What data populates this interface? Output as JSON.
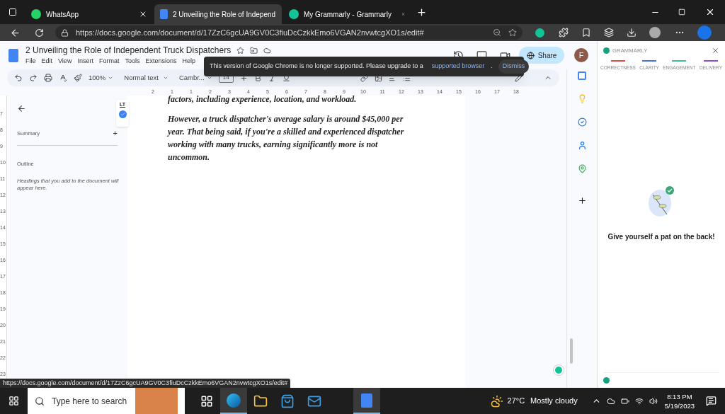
{
  "browser_tabs": [
    {
      "title": "WhatsApp",
      "selected": false
    },
    {
      "title": "2 Unveiling the Role of Independ",
      "selected": true
    },
    {
      "title": "My Grammarly - Grammarly",
      "selected": false
    }
  ],
  "address_bar": {
    "url": "https://docs.google.com/document/d/17ZzC6gcUA9GV0C3fiuDcCzkkEmo6VGAN2nvwtcgXO1s/edit#"
  },
  "document": {
    "title": "2 Unveiling the Role of Independent Truck Dispatchers",
    "menu": [
      "File",
      "Edit",
      "View",
      "Insert",
      "Format",
      "Tools",
      "Extensions",
      "Help"
    ],
    "share_label": "Share",
    "avatar_letter": "F",
    "toolbar": {
      "zoom": "100%",
      "style": "Normal text",
      "font": "Cambr...",
      "font_size": "14"
    },
    "ruler_labels": [
      "2",
      "1",
      "1",
      "2",
      "3",
      "4",
      "5",
      "6",
      "7",
      "8",
      "9",
      "10",
      "11",
      "12",
      "13",
      "14",
      "15",
      "16",
      "17",
      "18"
    ],
    "vertical_ruler_labels": [
      "7",
      "8",
      "9",
      "10",
      "11",
      "12",
      "13",
      "14",
      "15",
      "16",
      "17",
      "18",
      "19",
      "20",
      "21",
      "22",
      "23"
    ],
    "outline": {
      "summary_label": "Summary",
      "add_label": "+",
      "outline_label": "Outline",
      "hint": "Headings that you add to the document will appear here."
    },
    "lt_label": "LT",
    "paragraphs": [
      "factors, including experience, location, and workload.",
      "However, a truck dispatcher's average salary is around $45,000 per year. That being said, if you're a skilled and experienced dispatcher working with many trucks, earning significantly more is not uncommon."
    ]
  },
  "toast": {
    "message": "This version of Google Chrome is no longer supported. Please upgrade to a",
    "link": "supported browser",
    "period": ".",
    "dismiss": "Dismiss"
  },
  "grammarly": {
    "brand": "GRAMMARLY",
    "categories": [
      {
        "label": "CORRECTNESS",
        "color": "#e0484d"
      },
      {
        "label": "CLARITY",
        "color": "#4a6ee0"
      },
      {
        "label": "ENGAGEMENT",
        "color": "#3fbf8f"
      },
      {
        "label": "DELIVERY",
        "color": "#8a4fd0"
      }
    ],
    "message": "Give yourself a pat on the back!"
  },
  "status_url": "https://docs.google.com/document/d/17ZzC6gcUA9GV0C3fiuDcCzkkEmo6VGAN2nvwtcgXO1s/edit#",
  "taskbar": {
    "search_placeholder": "Type here to search",
    "apps": [
      {
        "kind": "taskview",
        "selected": false
      },
      {
        "kind": "edge",
        "selected": true
      },
      {
        "kind": "explorer",
        "selected": false
      },
      {
        "kind": "store",
        "selected": false
      },
      {
        "kind": "mail",
        "selected": false
      },
      {
        "kind": "docs",
        "selected": true
      }
    ],
    "temperature": "27°C",
    "weather": "Mostly cloudy",
    "time": "8:13 PM",
    "date": "5/19/2023"
  }
}
